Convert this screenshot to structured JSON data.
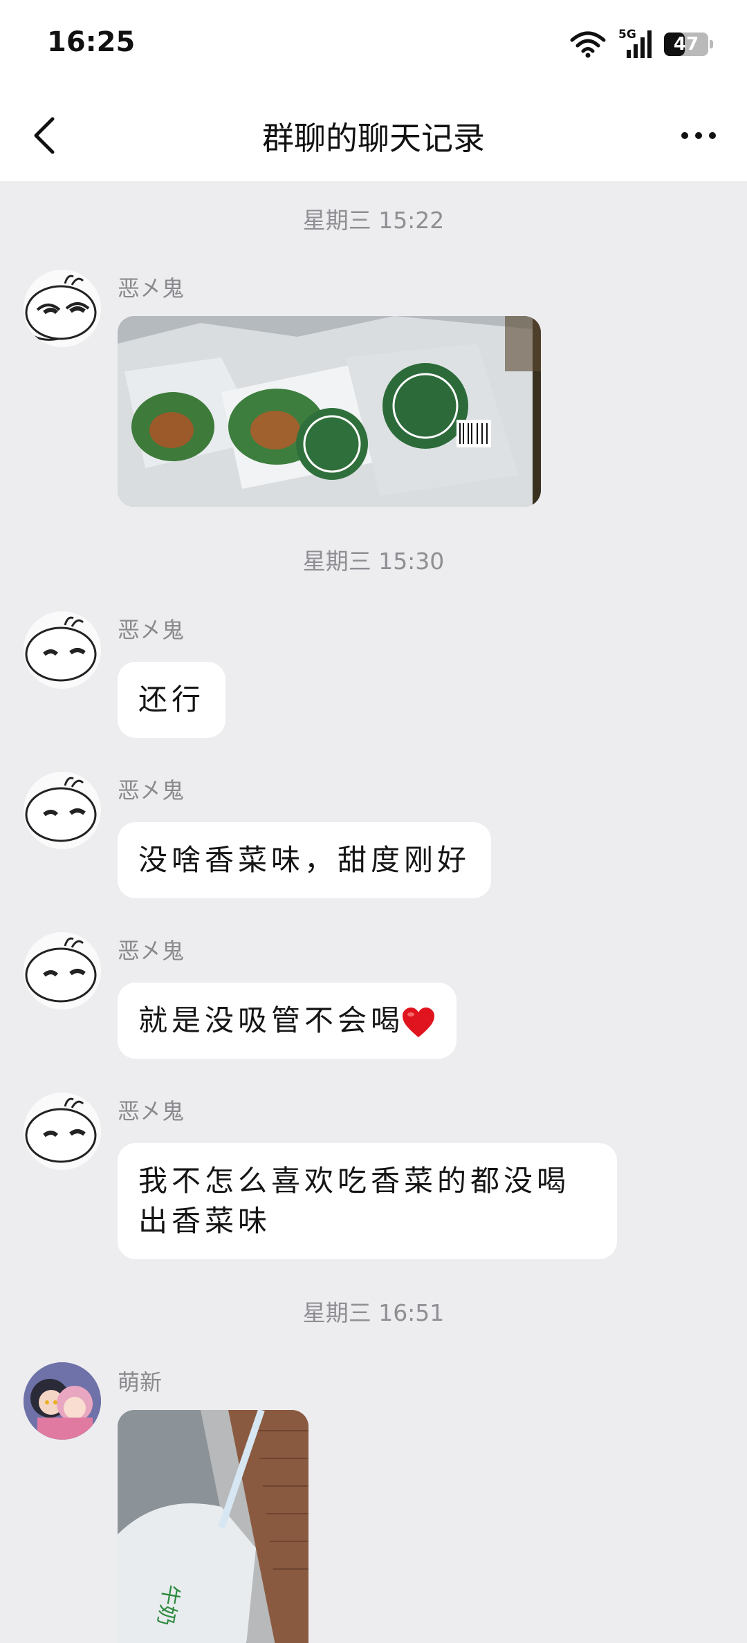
{
  "status_bar": {
    "time": "16:25",
    "network": "5G",
    "battery": "47",
    "battery_level": 0.47
  },
  "nav": {
    "title": "群聊的聊天记录",
    "back_icon": "chevron-left-icon",
    "more_icon": "more-dots-icon"
  },
  "messages": {
    "ts1": "星期三 15:22",
    "m1_sender": "恶㐅鬼",
    "ts2": "星期三 15:30",
    "m2_sender": "恶㐅鬼",
    "m2_text": "还行",
    "m3_sender": "恶㐅鬼",
    "m3_text": "没啥香菜味，甜度刚好",
    "m4_sender": "恶㐅鬼",
    "m4_text": "就是没吸管不会喝",
    "m5_sender": "恶㐅鬼",
    "m5_text": "我不怎么喜欢吃香菜的都没喝出香菜味",
    "ts3": "星期三 16:51",
    "m6_sender": "萌新"
  },
  "colors": {
    "background": "#EDEDF0",
    "bubble": "#FFFFFF",
    "meta_text": "#8E8E93"
  }
}
